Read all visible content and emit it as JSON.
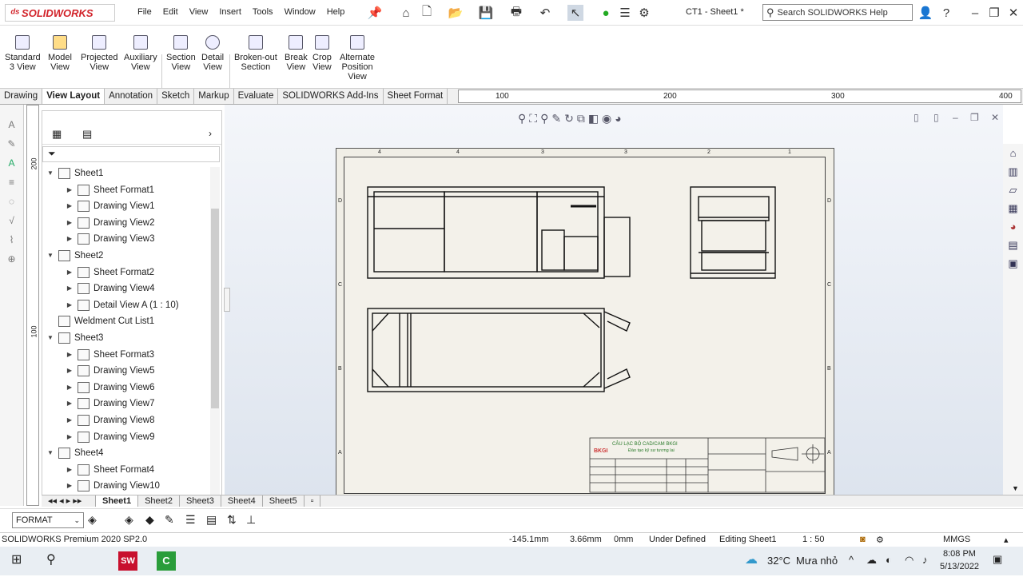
{
  "app": {
    "logo": "SOLIDWORKS",
    "doc_title": "CT1 - Sheet1 *",
    "search_placeholder": "Search SOLIDWORKS Help"
  },
  "menu": [
    "File",
    "Edit",
    "View",
    "Insert",
    "Tools",
    "Window",
    "Help"
  ],
  "commands": [
    {
      "label1": "Standard",
      "label2": "3 View",
      "label3": ""
    },
    {
      "label1": "Model",
      "label2": "View",
      "label3": ""
    },
    {
      "label1": "Projected",
      "label2": "View",
      "label3": ""
    },
    {
      "label1": "Auxiliary",
      "label2": "View",
      "label3": ""
    },
    {
      "label1": "Section",
      "label2": "View",
      "label3": ""
    },
    {
      "label1": "Detail",
      "label2": "View",
      "label3": ""
    },
    {
      "label1": "Broken-out",
      "label2": "Section",
      "label3": ""
    },
    {
      "label1": "Break",
      "label2": "View",
      "label3": ""
    },
    {
      "label1": "Crop",
      "label2": "View",
      "label3": ""
    },
    {
      "label1": "Alternate",
      "label2": "Position",
      "label3": "View"
    }
  ],
  "tabs": [
    "Drawing",
    "View Layout",
    "Annotation",
    "Sketch",
    "Markup",
    "Evaluate",
    "SOLIDWORKS Add-Ins",
    "Sheet Format"
  ],
  "active_tab": "View Layout",
  "ruler": {
    "h": [
      "100",
      "200",
      "300",
      "400"
    ],
    "v": [
      "200",
      "100"
    ]
  },
  "tree": [
    {
      "label": "Sheet1",
      "level": 0,
      "arrow": "▼"
    },
    {
      "label": "Sheet Format1",
      "level": 1,
      "arrow": "▶"
    },
    {
      "label": "Drawing View1",
      "level": 1,
      "arrow": "▶"
    },
    {
      "label": "Drawing View2",
      "level": 1,
      "arrow": "▶"
    },
    {
      "label": "Drawing View3",
      "level": 1,
      "arrow": "▶"
    },
    {
      "label": "Sheet2",
      "level": 0,
      "arrow": "▼"
    },
    {
      "label": "Sheet Format2",
      "level": 1,
      "arrow": "▶"
    },
    {
      "label": "Drawing View4",
      "level": 1,
      "arrow": "▶"
    },
    {
      "label": "Detail View A (1 : 10)",
      "level": 1,
      "arrow": "▶"
    },
    {
      "label": "Weldment Cut List1",
      "level": 0,
      "arrow": ""
    },
    {
      "label": "Sheet3",
      "level": 0,
      "arrow": "▼"
    },
    {
      "label": "Sheet Format3",
      "level": 1,
      "arrow": "▶"
    },
    {
      "label": "Drawing View5",
      "level": 1,
      "arrow": "▶"
    },
    {
      "label": "Drawing View6",
      "level": 1,
      "arrow": "▶"
    },
    {
      "label": "Drawing View7",
      "level": 1,
      "arrow": "▶"
    },
    {
      "label": "Drawing View8",
      "level": 1,
      "arrow": "▶"
    },
    {
      "label": "Drawing View9",
      "level": 1,
      "arrow": "▶"
    },
    {
      "label": "Sheet4",
      "level": 0,
      "arrow": "▼"
    },
    {
      "label": "Sheet Format4",
      "level": 1,
      "arrow": "▶"
    },
    {
      "label": "Drawing View10",
      "level": 1,
      "arrow": "▶"
    }
  ],
  "sheet_tabs": [
    "Sheet1",
    "Sheet2",
    "Sheet3",
    "Sheet4",
    "Sheet5"
  ],
  "active_sheet": "Sheet1",
  "zones": {
    "top": [
      "4",
      "3",
      "2",
      "1"
    ],
    "side": [
      "D",
      "C",
      "B",
      "A"
    ]
  },
  "titleblock": {
    "club": "CÂU LẠC BỘ CAD/CAM BKGI",
    "sub": "Đào tạo kỹ sư tương lai",
    "logo": "BKGI"
  },
  "format_select": "FORMAT",
  "status": {
    "product": "SOLIDWORKS Premium 2020 SP2.0",
    "x": "-145.1mm",
    "y": "3.66mm",
    "z": "0mm",
    "state": "Under Defined",
    "editing": "Editing Sheet1",
    "scale": "1 : 50",
    "units": "MMGS"
  },
  "taskbar": {
    "temp": "32°C",
    "weather": "Mưa nhỏ",
    "time": "8:08 PM",
    "date": "5/13/2022"
  }
}
